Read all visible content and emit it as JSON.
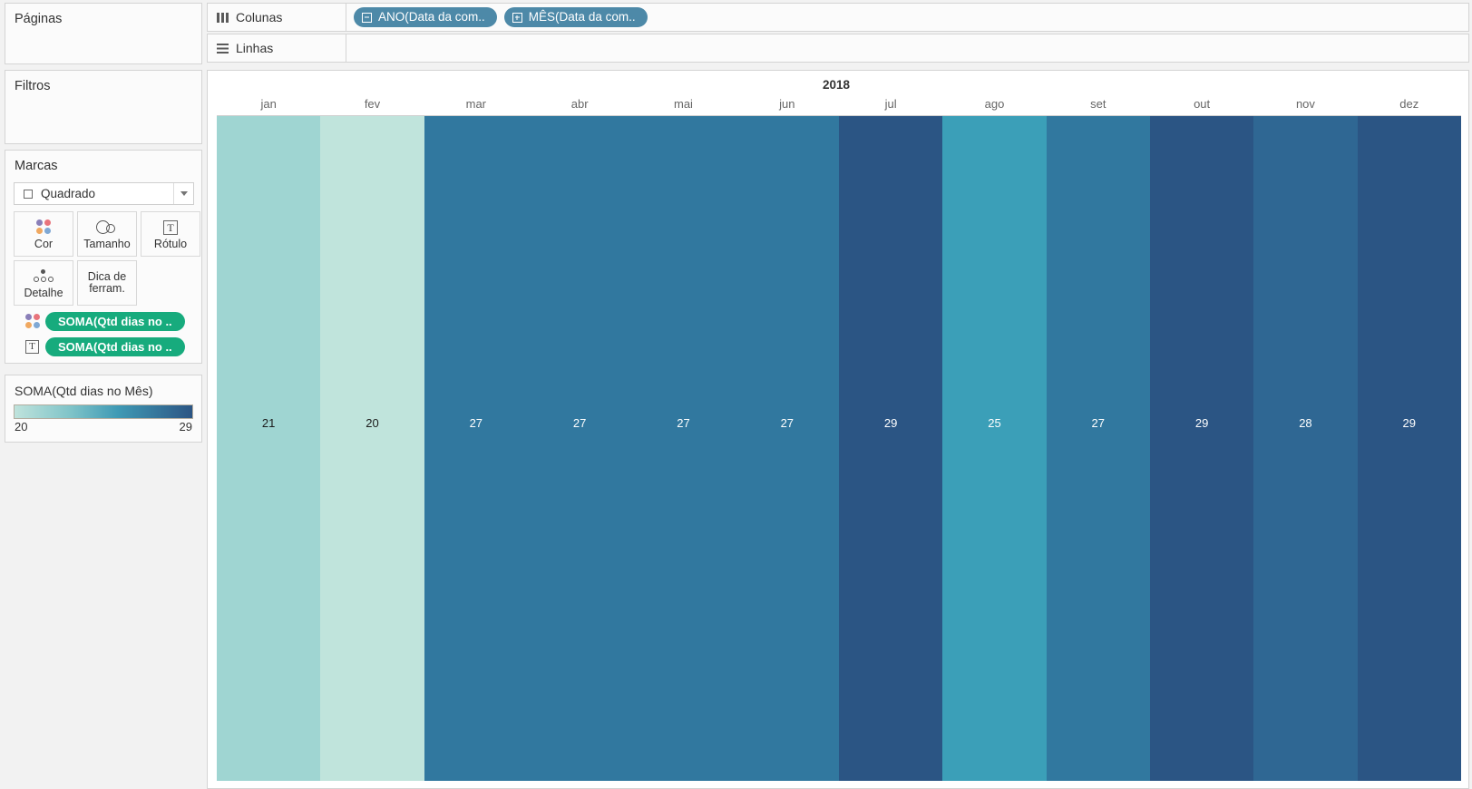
{
  "sidebar": {
    "pages": {
      "title": "Páginas"
    },
    "filters": {
      "title": "Filtros"
    },
    "marks": {
      "title": "Marcas",
      "mark_type": "Quadrado",
      "buttons": [
        {
          "label": "Cor",
          "icon": "color-dots-icon"
        },
        {
          "label": "Tamanho",
          "icon": "size-circles-icon"
        },
        {
          "label": "Rótulo",
          "icon": "label-t-icon"
        },
        {
          "label": "Detalhe",
          "icon": "detail-dots-icon"
        },
        {
          "label": "Dica de ferram.",
          "icon": "tooltip-icon"
        }
      ],
      "pills": [
        {
          "label": "SOMA(Qtd dias no ..",
          "icon": "color-dots-icon"
        },
        {
          "label": "SOMA(Qtd dias no ..",
          "icon": "label-t-icon"
        }
      ]
    },
    "legend": {
      "title": "SOMA(Qtd dias no Mês)",
      "min": "20",
      "max": "29",
      "gradient_start": "#bfe3dc",
      "gradient_end": "#2b5584"
    }
  },
  "shelves": {
    "columns": {
      "label": "Colunas",
      "icon": "columns-icon",
      "pills": [
        {
          "label": "ANO(Data da com..",
          "expand": "minus"
        },
        {
          "label": "MÊS(Data da com..",
          "expand": "plus"
        }
      ]
    },
    "rows": {
      "label": "Linhas",
      "icon": "rows-icon",
      "pills": []
    }
  },
  "chart_data": {
    "type": "heatmap",
    "title": "2018",
    "xlabel": "",
    "ylabel": "",
    "year": "2018",
    "categories": [
      "jan",
      "fev",
      "mar",
      "abr",
      "mai",
      "jun",
      "jul",
      "ago",
      "set",
      "out",
      "nov",
      "dez"
    ],
    "values": [
      21,
      20,
      27,
      27,
      27,
      27,
      29,
      25,
      27,
      29,
      28,
      29
    ],
    "colors": [
      "#9fd5d2",
      "#c0e4dc",
      "#31789f",
      "#31789f",
      "#31789f",
      "#31789f",
      "#2b5584",
      "#3b9fb8",
      "#31789f",
      "#2b5584",
      "#2f6793",
      "#2b5584"
    ],
    "label_colors": [
      "#1c1c1c",
      "#1c1c1c",
      "#ffffff",
      "#ffffff",
      "#ffffff",
      "#ffffff",
      "#ffffff",
      "#ffffff",
      "#ffffff",
      "#ffffff",
      "#ffffff",
      "#ffffff"
    ],
    "legend": {
      "label": "SOMA(Qtd dias no Mês)",
      "min": 20,
      "max": 29
    },
    "grid": false
  }
}
